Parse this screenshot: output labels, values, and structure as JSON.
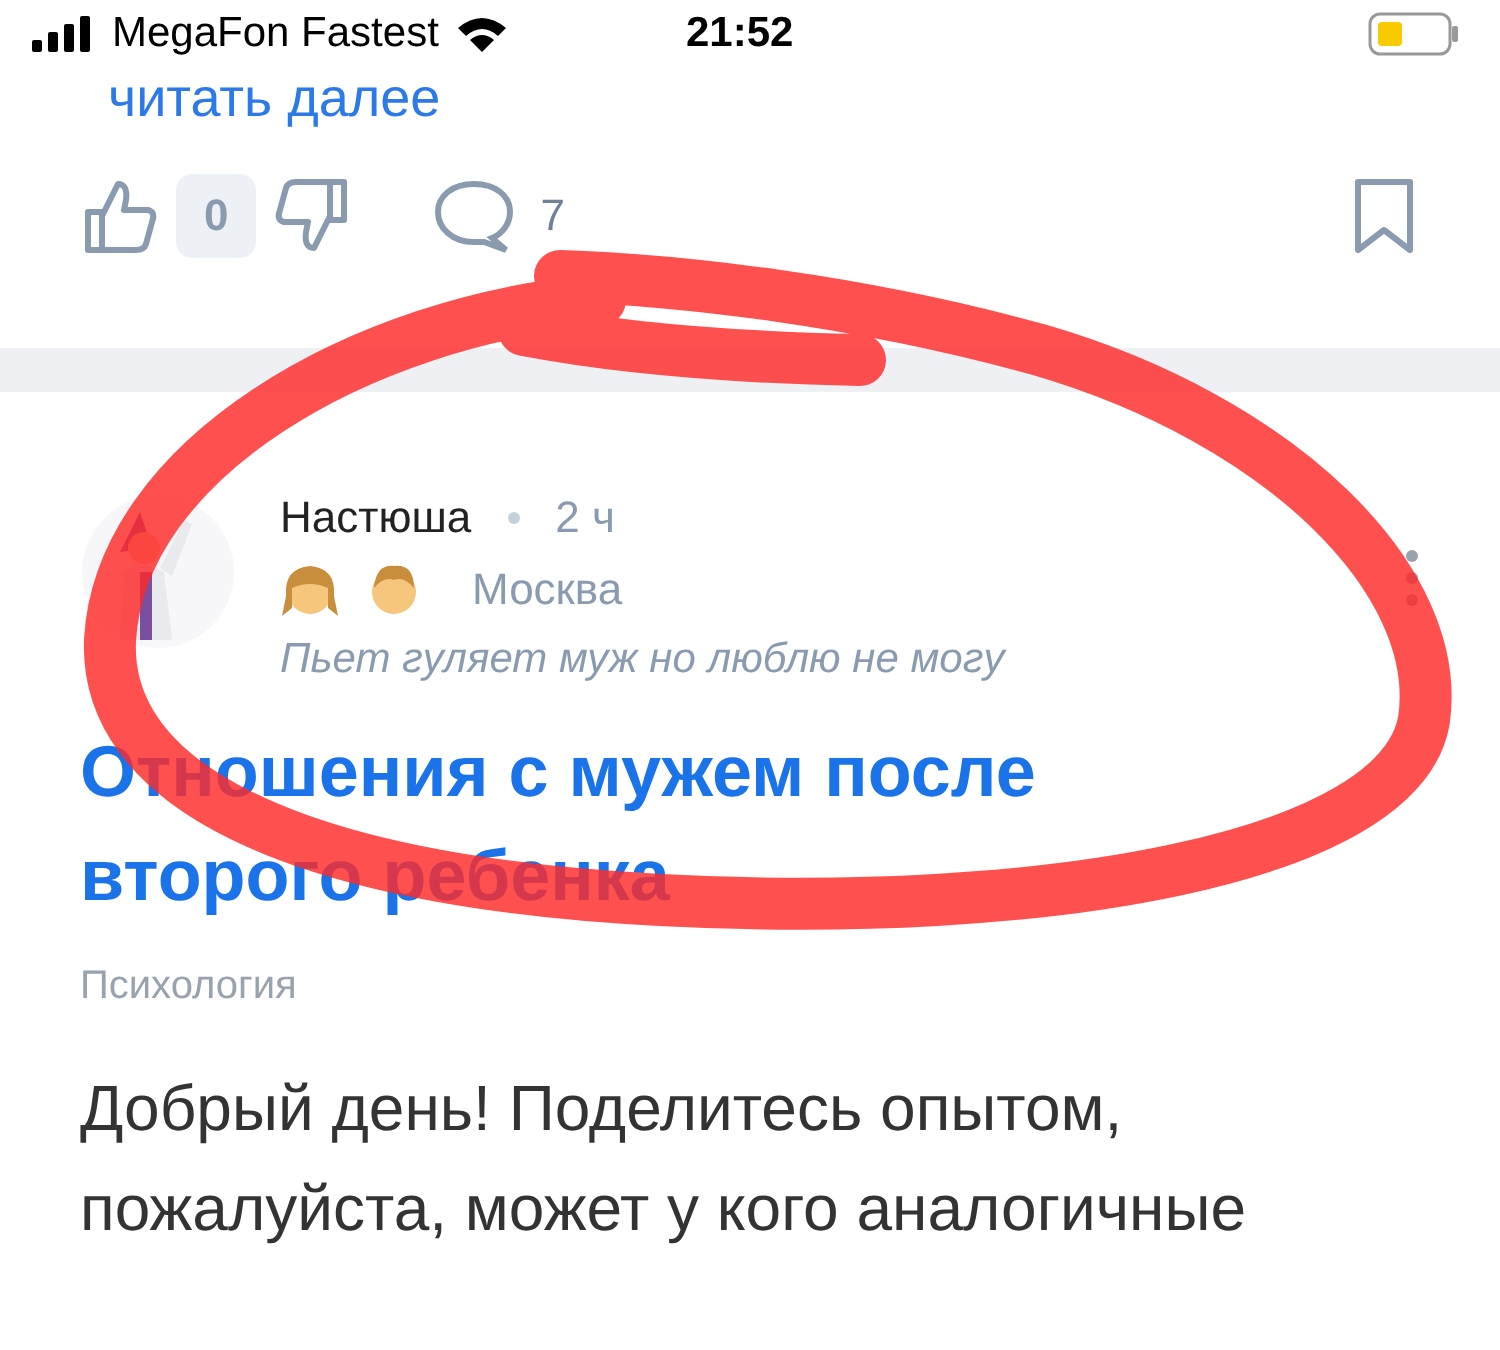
{
  "status_bar": {
    "carrier": "MegaFon Fastest",
    "time": "21:52"
  },
  "previous_post": {
    "read_more": "читать далее",
    "likes": "0",
    "comments": "7"
  },
  "post": {
    "author": "Настюша",
    "time": "2 ч",
    "family": [
      {
        "kind": "girl"
      },
      {
        "kind": "boy"
      }
    ],
    "city": "Москва",
    "status": "Пьет гуляет муж но люблю не могу",
    "title": "Отношения с мужем после второго ребенка",
    "category": "Психология",
    "body": "Добрый день! Поделитесь опытом, пожалуйста, может у кого аналогичные"
  },
  "annotation": {
    "kind": "circle"
  }
}
